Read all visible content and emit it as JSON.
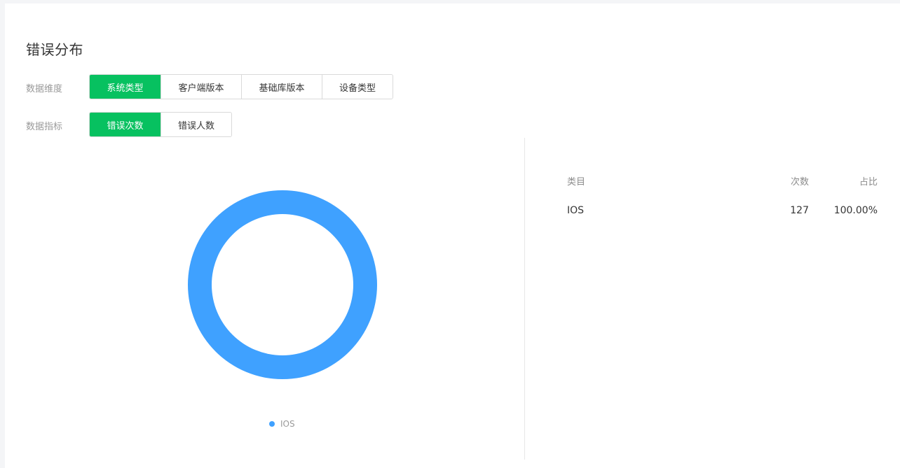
{
  "panel": {
    "title": "错误分布"
  },
  "dimension": {
    "label": "数据维度",
    "options": [
      "系统类型",
      "客户端版本",
      "基础库版本",
      "设备类型"
    ],
    "active_index": 0
  },
  "metric": {
    "label": "数据指标",
    "options": [
      "错误次数",
      "错误人数"
    ],
    "active_index": 0
  },
  "colors": {
    "accent": "#07c160",
    "series": "#3fa1ff"
  },
  "chart_data": {
    "type": "pie",
    "variant": "donut",
    "categories": [
      "IOS"
    ],
    "values": [
      127
    ],
    "legend": "bottom-center"
  },
  "table": {
    "headers": {
      "category": "类目",
      "count": "次数",
      "share": "占比"
    },
    "rows": [
      {
        "category": "IOS",
        "count": "127",
        "share": "100.00%"
      }
    ]
  }
}
